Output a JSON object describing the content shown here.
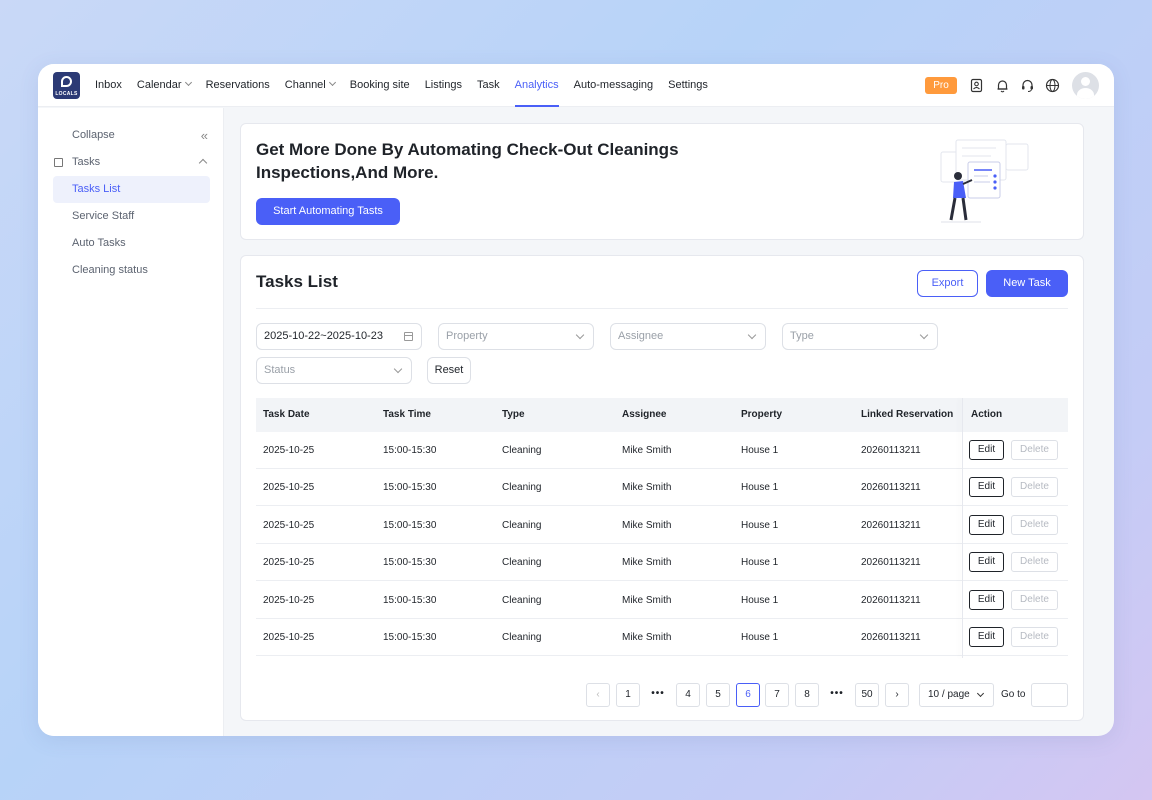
{
  "brand": {
    "logo_text": "LOCALS"
  },
  "nav": {
    "items": [
      {
        "label": "Inbox",
        "dropdown": false
      },
      {
        "label": "Calendar",
        "dropdown": true
      },
      {
        "label": "Reservations",
        "dropdown": false
      },
      {
        "label": "Channel",
        "dropdown": true
      },
      {
        "label": "Booking site",
        "dropdown": false
      },
      {
        "label": "Listings",
        "dropdown": false
      },
      {
        "label": "Task",
        "dropdown": false
      },
      {
        "label": "Analytics",
        "dropdown": false,
        "active": true
      },
      {
        "label": "Auto-messaging",
        "dropdown": false
      },
      {
        "label": "Settings",
        "dropdown": false
      }
    ],
    "pro_badge": "Pro"
  },
  "sidebar": {
    "collapse_label": "Collapse",
    "collapse_icon": "«",
    "group_label": "Tasks",
    "items": [
      {
        "label": "Tasks List",
        "active": true
      },
      {
        "label": "Service Staff"
      },
      {
        "label": "Auto Tasks"
      },
      {
        "label": "Cleaning status"
      }
    ]
  },
  "banner": {
    "title_line1": "Get More Done By Automating Check-Out Cleanings",
    "title_line2": "Inspections,And More.",
    "cta": "Start Automating Tasts"
  },
  "tasks": {
    "title": "Tasks List",
    "export_label": "Export",
    "new_label": "New Task",
    "filters": {
      "date_range": "2025-10-22~2025-10-23",
      "property_placeholder": "Property",
      "assignee_placeholder": "Assignee",
      "type_placeholder": "Type",
      "status_placeholder": "Status",
      "reset_label": "Reset"
    },
    "columns": [
      "Task Date",
      "Task Time",
      "Type",
      "Assignee",
      "Property",
      "Linked Reservation",
      "Action"
    ],
    "rows": [
      {
        "date": "2025-10-25",
        "time": "15:00-15:30",
        "type": "Cleaning",
        "assignee": "Mike Smith",
        "property": "House 1",
        "reservation": "20260113211"
      },
      {
        "date": "2025-10-25",
        "time": "15:00-15:30",
        "type": "Cleaning",
        "assignee": "Mike Smith",
        "property": "House 1",
        "reservation": "20260113211"
      },
      {
        "date": "2025-10-25",
        "time": "15:00-15:30",
        "type": "Cleaning",
        "assignee": "Mike Smith",
        "property": "House 1",
        "reservation": "20260113211"
      },
      {
        "date": "2025-10-25",
        "time": "15:00-15:30",
        "type": "Cleaning",
        "assignee": "Mike Smith",
        "property": "House 1",
        "reservation": "20260113211"
      },
      {
        "date": "2025-10-25",
        "time": "15:00-15:30",
        "type": "Cleaning",
        "assignee": "Mike Smith",
        "property": "House 1",
        "reservation": "20260113211"
      },
      {
        "date": "2025-10-25",
        "time": "15:00-15:30",
        "type": "Cleaning",
        "assignee": "Mike Smith",
        "property": "House 1",
        "reservation": "20260113211"
      }
    ],
    "edit_label": "Edit",
    "delete_label": "Delete"
  },
  "pagination": {
    "prev": "‹",
    "next": "›",
    "pages": [
      "1",
      "•••",
      "4",
      "5",
      "6",
      "7",
      "8",
      "•••",
      "50"
    ],
    "current": "6",
    "page_size": "10 / page",
    "goto_label": "Go to"
  },
  "colors": {
    "accent": "#4a5ff7",
    "pro": "#ff9a3c",
    "brand": "#2c3a75"
  }
}
